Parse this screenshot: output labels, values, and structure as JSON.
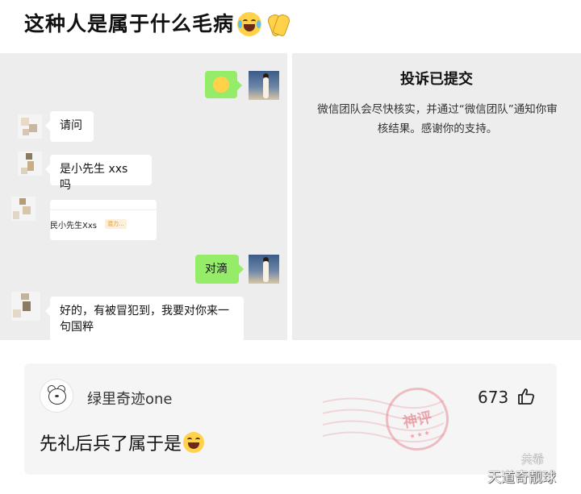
{
  "title": "这种人是属于什么毛病",
  "chat": {
    "messages": [
      {
        "side": "right",
        "text": ""
      },
      {
        "side": "left",
        "text": "请问"
      },
      {
        "side": "left",
        "text": "是小先生 xxs 吗"
      },
      {
        "side": "left",
        "card_text": "民小先生Xxs",
        "card_tag": "潜力..."
      },
      {
        "side": "right",
        "text": "对滴"
      },
      {
        "side": "left",
        "text": "好的，有被冒犯到，我要对你来一句国粹"
      }
    ]
  },
  "complaint": {
    "title": "投诉已提交",
    "body": "微信团队会尽快核实，并通过“微信团队”通知你审核结果。感谢你的支持。"
  },
  "comment": {
    "username": "绿里奇迹one",
    "likes": "673",
    "text": "先礼后兵了属于是",
    "stamp_text": "神评"
  },
  "watermark": {
    "line1": "共希",
    "line2": "天道奇靓球"
  },
  "icons": {
    "title_emojis": [
      "crying-laughing-emoji-icon",
      "hands-emoji-icon"
    ],
    "like": "thumbs-up-icon"
  }
}
